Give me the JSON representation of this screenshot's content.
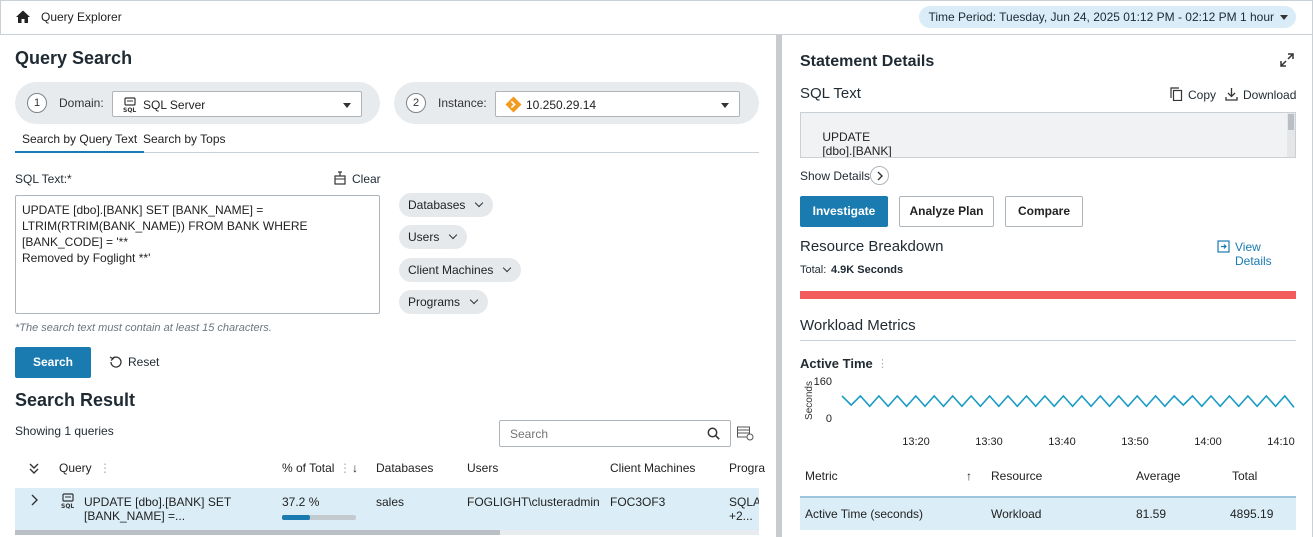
{
  "header": {
    "app_title": "Query Explorer",
    "time_period": "Time Period: Tuesday, Jun 24, 2025 01:12 PM - 02:12 PM 1 hour"
  },
  "query_search": {
    "title": "Query Search",
    "domain": {
      "step": "1",
      "label": "Domain:",
      "value": "SQL Server",
      "icon": "sql-server-icon"
    },
    "instance": {
      "step": "2",
      "label": "Instance:",
      "value": "10.250.29.14",
      "icon": "instance-diamond-icon"
    },
    "tabs": [
      "Search by Query Text",
      "Search by Tops"
    ],
    "sql_text_label": "SQL Text:*",
    "clear_label": "Clear",
    "sql_text_value": "UPDATE [dbo].[BANK] SET [BANK_NAME] =\nLTRIM(RTRIM(BANK_NAME)) FROM BANK WHERE [BANK_CODE] = '**\nRemoved by Foglight **'",
    "hint": "*The search text must contain at least 15 characters.",
    "filters": [
      "Databases",
      "Users",
      "Client Machines",
      "Programs"
    ],
    "search_button": "Search",
    "reset_button": "Reset"
  },
  "search_result": {
    "title": "Search Result",
    "summary": "Showing 1 queries",
    "search_placeholder": "Search",
    "columns": [
      "Query",
      "% of Total",
      "Databases",
      "Users",
      "Client Machines",
      "Progra"
    ],
    "rows": [
      {
        "query_line1": "UPDATE [dbo].[BANK] SET",
        "query_line2": "[BANK_NAME] =...",
        "percent": "37.2 %",
        "percent_value": 37.2,
        "database": "sales",
        "user": "FOGLIGHT\\clusteradmin",
        "client": "FOC3OF3",
        "program_line1": "SQLAg",
        "program_line2": "+2..."
      }
    ]
  },
  "statement_details": {
    "title": "Statement Details",
    "sql_text_title": "SQL Text",
    "copy_label": "Copy",
    "download_label": "Download",
    "sql_text": "UPDATE\n    [dbo].[BANK]\nSET",
    "show_details": "Show Details",
    "buttons": {
      "investigate": "Investigate",
      "analyze_plan": "Analyze Plan",
      "compare": "Compare"
    },
    "resource_breakdown": {
      "title": "Resource Breakdown",
      "view_details": "View Details",
      "total_label": "Total:",
      "total_value": "4.9K Seconds",
      "bar_color": "#f25c5c"
    },
    "workload_metrics": {
      "title": "Workload Metrics",
      "active_time_title": "Active Time",
      "table_columns": [
        "Metric",
        "Resource",
        "Average",
        "Total"
      ],
      "table_rows": [
        {
          "metric": "Active Time (seconds)",
          "resource": "Workload",
          "average": "81.59",
          "total": "4895.19"
        }
      ]
    }
  },
  "chart_data": {
    "type": "line",
    "title": "Active Time",
    "ylabel": "Seconds",
    "xlabel": "",
    "ylim": [
      0,
      160
    ],
    "yticks": [
      "0",
      "160"
    ],
    "xticks": [
      "13:20",
      "13:30",
      "13:40",
      "13:50",
      "14:00",
      "14:10"
    ],
    "series": [
      {
        "values": [
          100,
          60,
          100,
          55,
          100,
          55,
          100,
          55,
          100,
          55,
          100,
          55,
          100,
          55,
          100,
          55,
          100,
          55,
          100,
          55,
          100,
          55,
          100,
          55,
          100,
          55,
          100,
          55,
          100,
          55,
          100,
          55,
          100,
          55,
          100,
          55,
          100,
          60,
          100,
          55,
          100,
          55,
          100,
          55,
          100,
          55,
          100,
          55,
          100,
          50
        ]
      }
    ],
    "color": "#1a9bc4"
  }
}
